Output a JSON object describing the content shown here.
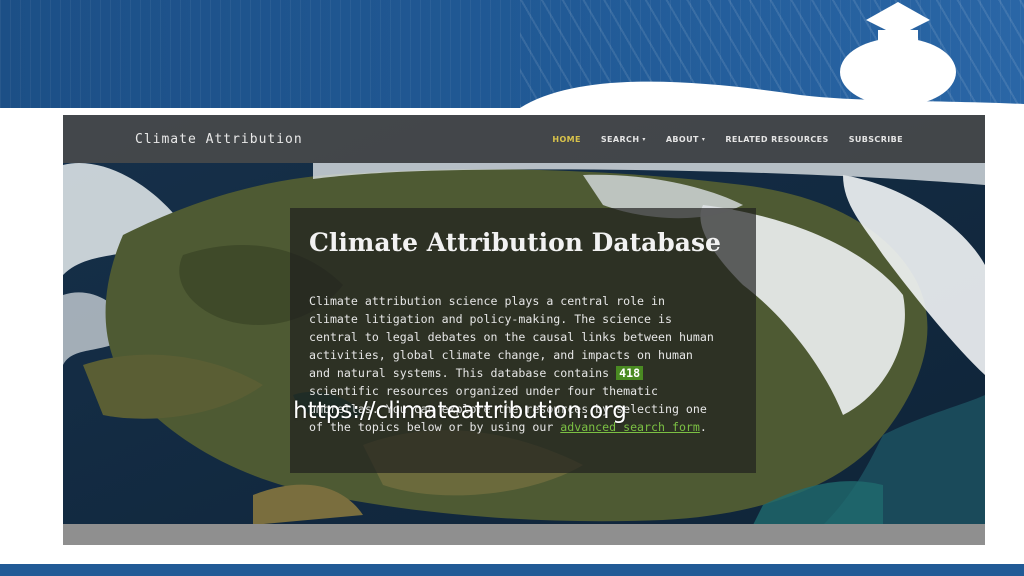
{
  "navbar": {
    "brand": "Climate Attribution",
    "items": [
      {
        "label": "HOME",
        "active": true,
        "dropdown": false
      },
      {
        "label": "SEARCH",
        "active": false,
        "dropdown": true
      },
      {
        "label": "ABOUT",
        "active": false,
        "dropdown": true
      },
      {
        "label": "RELATED RESOURCES",
        "active": false,
        "dropdown": false
      },
      {
        "label": "SUBSCRIBE",
        "active": false,
        "dropdown": false
      }
    ],
    "active_color": "#d8c24a"
  },
  "hero": {
    "title": "Climate Attribution Database",
    "text_before": "Climate attribution science plays a central role in\nclimate litigation and policy-making. The science is\ncentral to legal debates on the causal links between human\nactivities, global climate change, and impacts on human\nand natural systems. This database contains ",
    "count": "418",
    "text_middle": "\nscientific resources organized under four thematic\numbrellas. You can explore the resources by selecting one\nof the topics below or by using our ",
    "link_text": "advanced search form",
    "text_after": "."
  },
  "caption": {
    "url": "https://climateattribution.org"
  },
  "colors": {
    "slide_band": "#215a96",
    "badge": "#4a8a22",
    "link": "#7bc043"
  }
}
